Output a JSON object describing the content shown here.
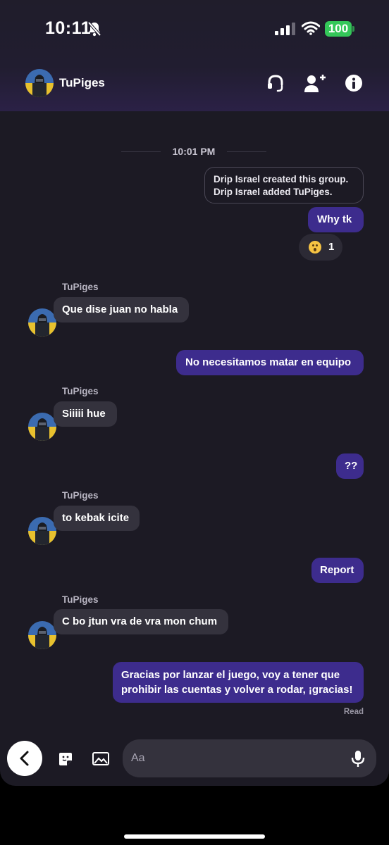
{
  "status_bar": {
    "time": "10:11",
    "battery": "100"
  },
  "header": {
    "contact_name": "TuPiges"
  },
  "conversation": {
    "time_separator": "10:01 PM",
    "system_notice": [
      "Drip Israel created this group.",
      "Drip Israel added TuPiges."
    ],
    "reaction": {
      "count": "1"
    },
    "messages": [
      {
        "sender": "",
        "text": "Why tk"
      },
      {
        "sender": "TuPiges",
        "text": "Que dise juan no habla"
      },
      {
        "sender": "",
        "text": "No necesitamos matar en equipo"
      },
      {
        "sender": "TuPiges",
        "text": "Siiiii hue"
      },
      {
        "sender": "",
        "text": "??"
      },
      {
        "sender": "TuPiges",
        "text": "to kebak icite"
      },
      {
        "sender": "",
        "text": "Report"
      },
      {
        "sender": "TuPiges",
        "text": "C bo jtun vra de vra mon chum"
      },
      {
        "sender": "",
        "text_lines": [
          "Gracias por lanzar el juego, voy a tener que",
          "prohibir las cuentas y volver a rodar, ¡gracias!"
        ]
      }
    ],
    "read_receipt": "Read"
  },
  "composer": {
    "placeholder": "Aa"
  },
  "colors": {
    "accent_outgoing": "#3d2c8d",
    "incoming_bubble": "#34323d",
    "background": "#1c1a24",
    "battery_green": "#34c759"
  },
  "icons": [
    "bell-off-icon",
    "signal-icon",
    "wifi-icon",
    "headset-icon",
    "add-person-icon",
    "info-icon",
    "back-icon",
    "sticker-icon",
    "image-icon",
    "mic-icon",
    "wow-emoji-icon"
  ]
}
